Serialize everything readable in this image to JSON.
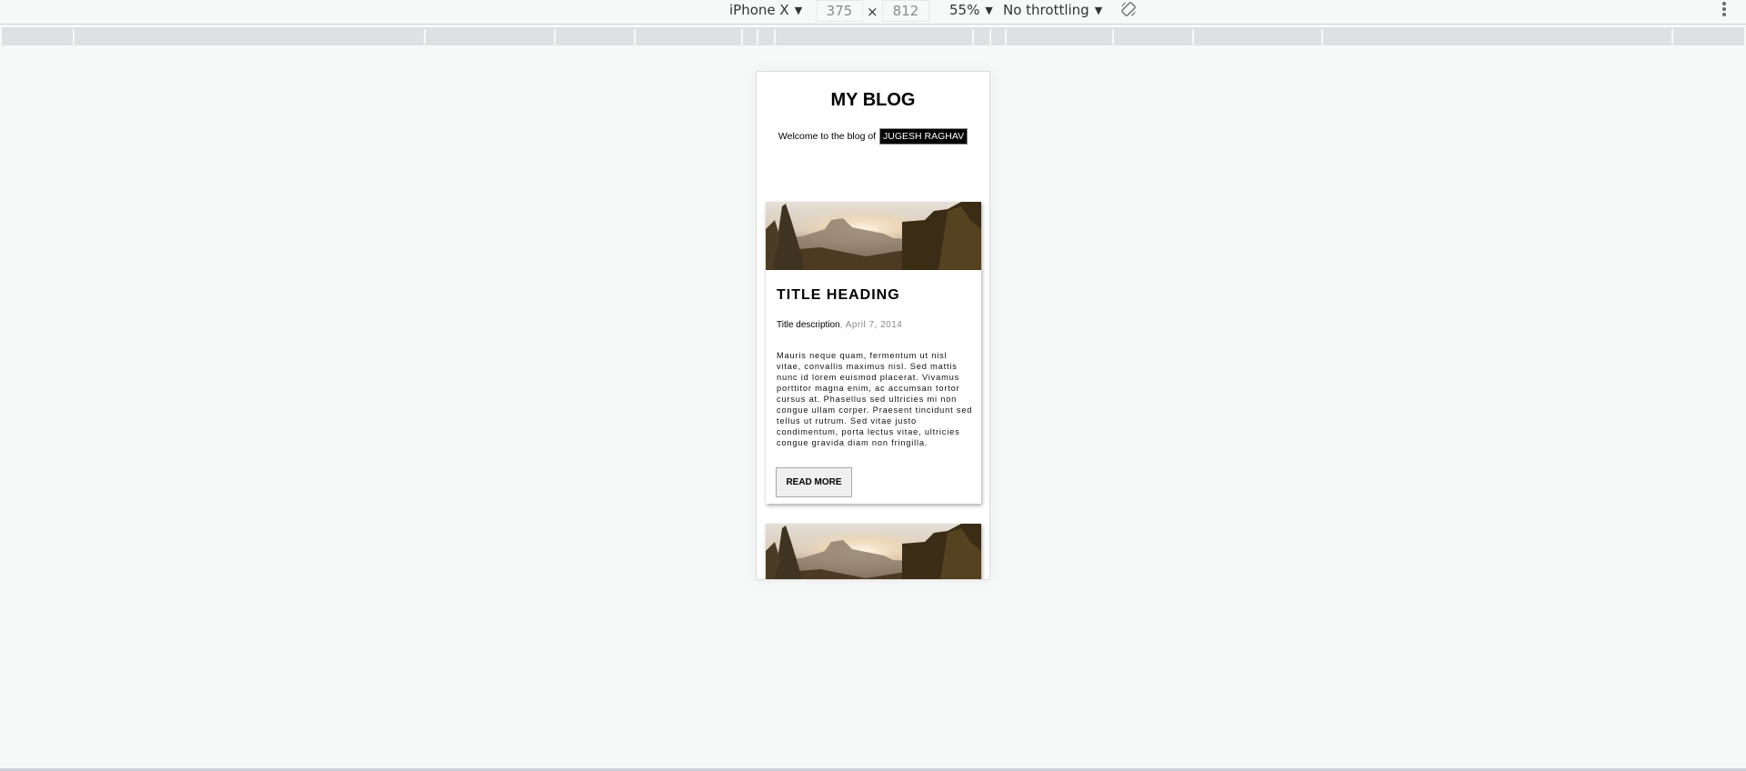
{
  "devtools_toolbar": {
    "device": "iPhone X",
    "width": "375",
    "height": "812",
    "dimension_separator": "×",
    "zoom": "55%",
    "throttling": "No throttling",
    "rotate_icon": "rotate-icon",
    "more_icon": "more-vertical-icon",
    "caret": "▼"
  },
  "page": {
    "blog_title": "MY BLOG",
    "welcome_text": "Welcome to the blog of",
    "author": "JUGESH RAGHAV",
    "posts": [
      {
        "image": "mountain-sunset-image",
        "title": "TITLE HEADING",
        "description": "Title description",
        "date_separator": ", ",
        "date": "April 7, 2014",
        "body": "Mauris neque quam, fermentum ut nisl vitae, convallis maximus nisl. Sed mattis nunc id lorem euismod placerat. Vivamus porttitor magna enim, ac accumsan tortor cursus at. Phasellus sed ultricies mi non congue ullam corper. Praesent tincidunt sed tellus ut rutrum. Sed vitae justo condimentum, porta lectus vitae, ultricies congue gravida diam non fringilla.",
        "button_label": "READ MORE"
      },
      {
        "image": "mountain-sunset-image"
      }
    ]
  },
  "colors": {
    "page_background": "#f7f9f9",
    "ruler": "#dee0e4",
    "author_badge_bg": "#000000",
    "author_badge_text": "#ffffff",
    "date_text": "#888888",
    "button_bg": "#efefef"
  }
}
